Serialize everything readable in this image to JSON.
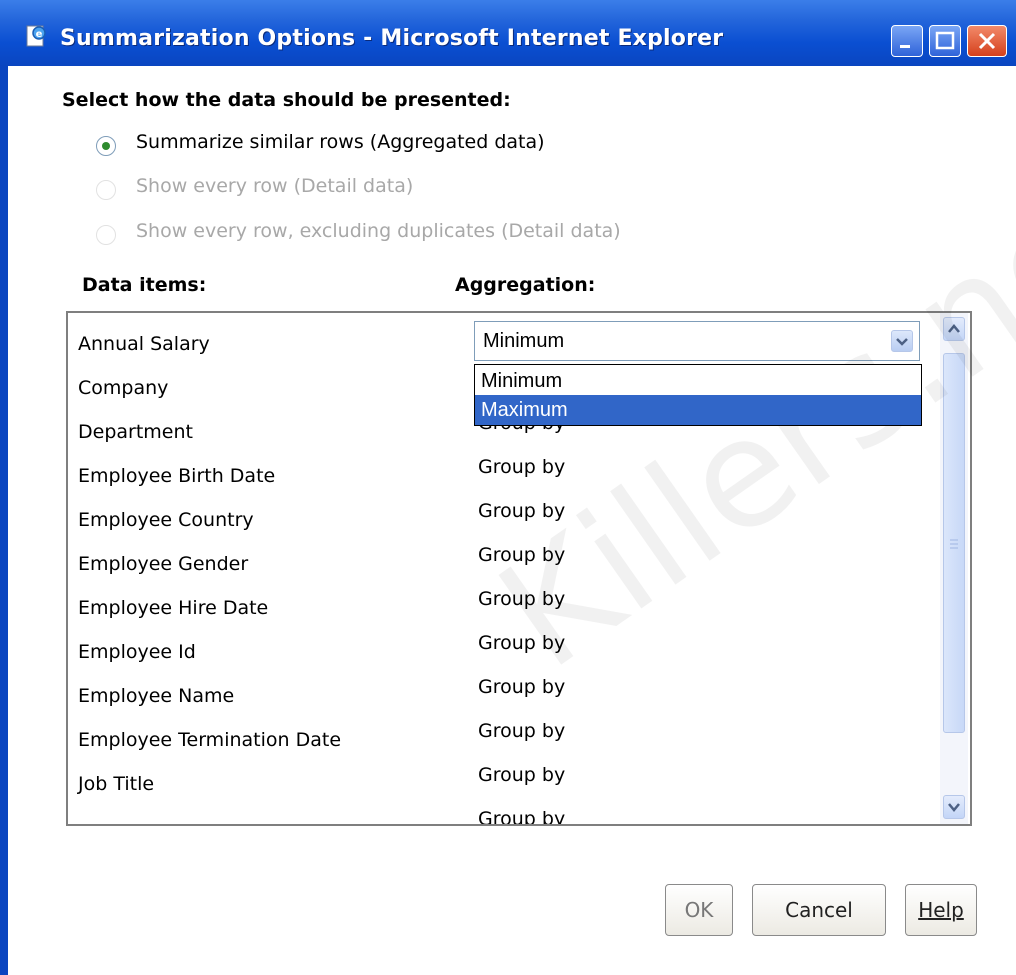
{
  "window": {
    "title": "Summarization Options - Microsoft Internet Explorer",
    "colors": {
      "titlebar": "#0a4fd2",
      "selection": "#3166c8",
      "radio_selected": "#2e8b2e"
    }
  },
  "presentation": {
    "heading": "Select how the data should be presented:",
    "options": [
      {
        "label": "Summarize similar rows (Aggregated data)",
        "selected": true,
        "enabled": true
      },
      {
        "label": "Show every row (Detail data)",
        "selected": false,
        "enabled": false
      },
      {
        "label": "Show every row, excluding duplicates (Detail data)",
        "selected": false,
        "enabled": false
      }
    ]
  },
  "columns": {
    "data_items": "Data items:",
    "aggregation": "Aggregation:"
  },
  "items": [
    {
      "name": "Annual Salary",
      "aggregation": "Minimum"
    },
    {
      "name": "Company",
      "aggregation": "Group by"
    },
    {
      "name": "Department",
      "aggregation": "Group by"
    },
    {
      "name": "Employee Birth Date",
      "aggregation": "Group by"
    },
    {
      "name": "Employee Country",
      "aggregation": "Group by"
    },
    {
      "name": "Employee Gender",
      "aggregation": "Group by"
    },
    {
      "name": "Employee Hire Date",
      "aggregation": "Group by"
    },
    {
      "name": "Employee Id",
      "aggregation": "Group by"
    },
    {
      "name": "Employee Name",
      "aggregation": "Group by"
    },
    {
      "name": "Employee Termination Date",
      "aggregation": "Group by"
    },
    {
      "name": "Job Title",
      "aggregation": "Group by"
    },
    {
      "name": "",
      "aggregation": "Group by"
    }
  ],
  "dropdown": {
    "value": "Minimum",
    "options": [
      "Minimum",
      "Maximum"
    ],
    "highlighted": "Maximum"
  },
  "buttons": {
    "ok": "OK",
    "cancel": "Cancel",
    "help": "Help"
  },
  "watermark": "Killers.net"
}
